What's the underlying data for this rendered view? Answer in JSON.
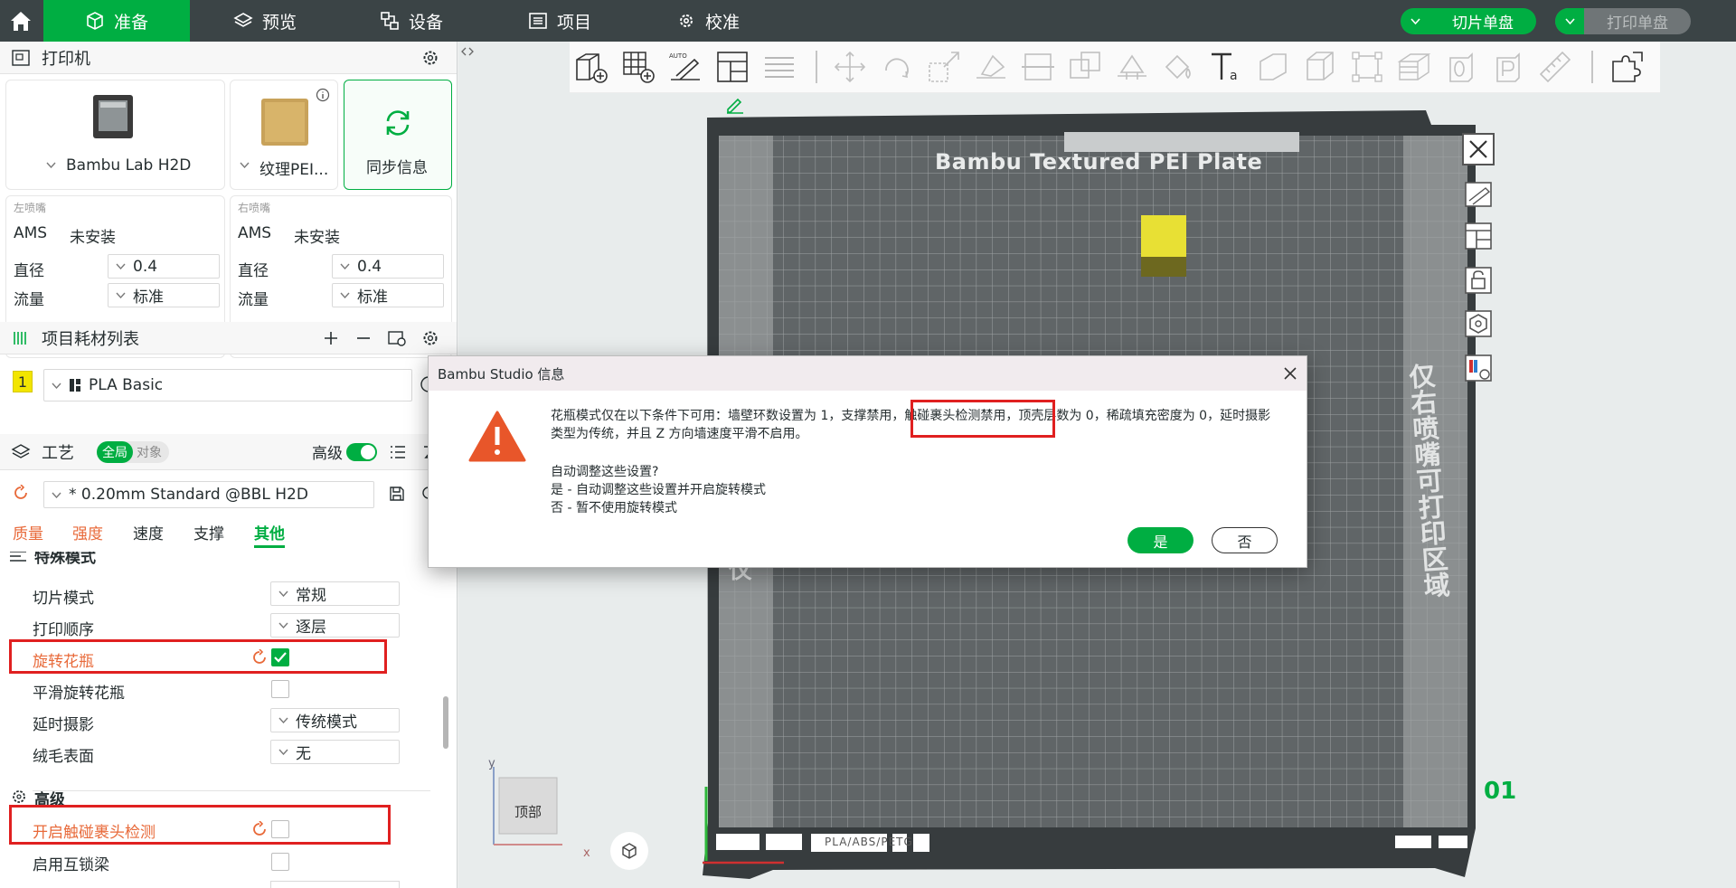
{
  "topbar": {
    "tabs": [
      {
        "label": "准备",
        "icon": "cube-icon",
        "active": true
      },
      {
        "label": "预览",
        "icon": "layers-icon",
        "active": false
      },
      {
        "label": "设备",
        "icon": "device-icon",
        "active": false
      },
      {
        "label": "项目",
        "icon": "list-icon",
        "active": false
      },
      {
        "label": "校准",
        "icon": "gear-icon",
        "active": false
      }
    ],
    "slice_button": "切片单盘",
    "print_button": "打印单盘",
    "accent": "#00ae42"
  },
  "printer": {
    "title": "打印机",
    "model": "Bambu Lab H2D",
    "plate": "纹理PEI...",
    "sync": "同步信息",
    "left_nozzle": {
      "caption": "左喷嘴",
      "ams_label": "AMS",
      "ams_value": "未安装",
      "diameter_label": "直径",
      "diameter": "0.4",
      "flow_label": "流量",
      "flow": "标准"
    },
    "right_nozzle": {
      "caption": "右喷嘴",
      "ams_label": "AMS",
      "ams_value": "未安装",
      "diameter_label": "直径",
      "diameter": "0.4",
      "flow_label": "流量",
      "flow": "标准"
    }
  },
  "filament": {
    "title": "项目耗材列表",
    "item_index": "1",
    "item_name": "PLA Basic",
    "item_color": "#f2e500"
  },
  "process": {
    "title": "工艺",
    "toggle_global": "全局",
    "toggle_object": "对象",
    "advanced_label": "高级",
    "preset": "* 0.20mm Standard @BBL H2D",
    "tabs": [
      "质量",
      "强度",
      "速度",
      "支撑",
      "其他"
    ],
    "active_tab": "其他",
    "special_mode_header": "特殊模式",
    "slice_mode_label": "切片模式",
    "slice_mode": "常规",
    "print_order_label": "打印顺序",
    "print_order": "逐层",
    "vase_label": "旋转花瓶",
    "vase_checked": true,
    "smooth_vase_label": "平滑旋转花瓶",
    "timelapse_label": "延时摄影",
    "timelapse": "传统模式",
    "fuzzy_label": "绒毛表面",
    "fuzzy": "无",
    "advanced_header": "高级",
    "clump_detect_label": "开启触碰裹头检测",
    "interlock_label": "启用互锁梁"
  },
  "viewport": {
    "plate_title": "Bambu Textured PEI Plate",
    "side_text": "仅右喷嘴可打印区域",
    "left_edge_text": "仅",
    "plate_number": "01",
    "plate_footer": "PLA/ABS/PETG",
    "view_cube_label": "顶部",
    "axis_x": "x",
    "axis_y": "y"
  },
  "dialog": {
    "title": "Bambu Studio 信息",
    "message_part1": "花瓶模式仅在以下条件下可用：墙壁环数设置为 1，支撑禁用，",
    "message_highlight": "触碰裹头检测禁用，",
    "message_part2": "顶壳层数为 0，稀疏填充密度为 0，延时摄影类型为传统，并且 Z 方向墙速度平滑不启用。",
    "question": "自动调整这些设置?",
    "yes_desc": "是 - 自动调整这些设置并开启旋转模式",
    "no_desc": "否 - 暂不使用旋转模式",
    "yes_button": "是",
    "no_button": "否"
  }
}
